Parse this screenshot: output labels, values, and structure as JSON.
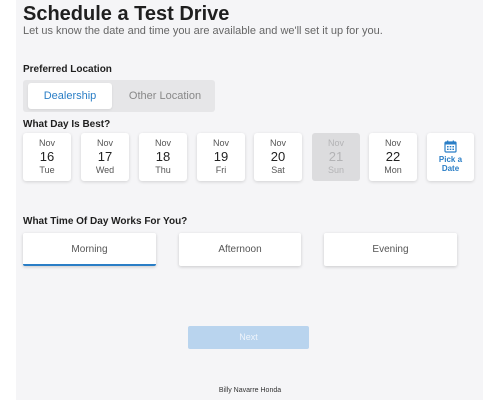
{
  "header": {
    "title": "Schedule a Test Drive",
    "subtitle": "Let us know the date and time you are available and we'll set it up for you."
  },
  "location": {
    "label": "Preferred Location",
    "options": [
      {
        "label": "Dealership",
        "selected": true
      },
      {
        "label": "Other Location",
        "selected": false
      }
    ]
  },
  "day": {
    "label": "What Day Is Best?",
    "days": [
      {
        "month": "Nov",
        "date": "16",
        "weekday": "Tue",
        "disabled": false
      },
      {
        "month": "Nov",
        "date": "17",
        "weekday": "Wed",
        "disabled": false
      },
      {
        "month": "Nov",
        "date": "18",
        "weekday": "Thu",
        "disabled": false
      },
      {
        "month": "Nov",
        "date": "19",
        "weekday": "Fri",
        "disabled": false
      },
      {
        "month": "Nov",
        "date": "20",
        "weekday": "Sat",
        "disabled": false
      },
      {
        "month": "Nov",
        "date": "21",
        "weekday": "Sun",
        "disabled": true
      },
      {
        "month": "Nov",
        "date": "22",
        "weekday": "Mon",
        "disabled": false
      }
    ],
    "pick_label": "Pick a Date",
    "pick_icon": "calendar-icon"
  },
  "time": {
    "label": "What Time Of Day Works For You?",
    "options": [
      {
        "label": "Morning",
        "selected": true
      },
      {
        "label": "Afternoon",
        "selected": false
      },
      {
        "label": "Evening",
        "selected": false
      }
    ]
  },
  "actions": {
    "next_label": "Next"
  },
  "footer": {
    "dealer": "Billy Navarre Honda"
  },
  "colors": {
    "accent": "#2a7ec6",
    "next_disabled": "#b9d4ee",
    "panel_bg": "#f5f5f7"
  }
}
